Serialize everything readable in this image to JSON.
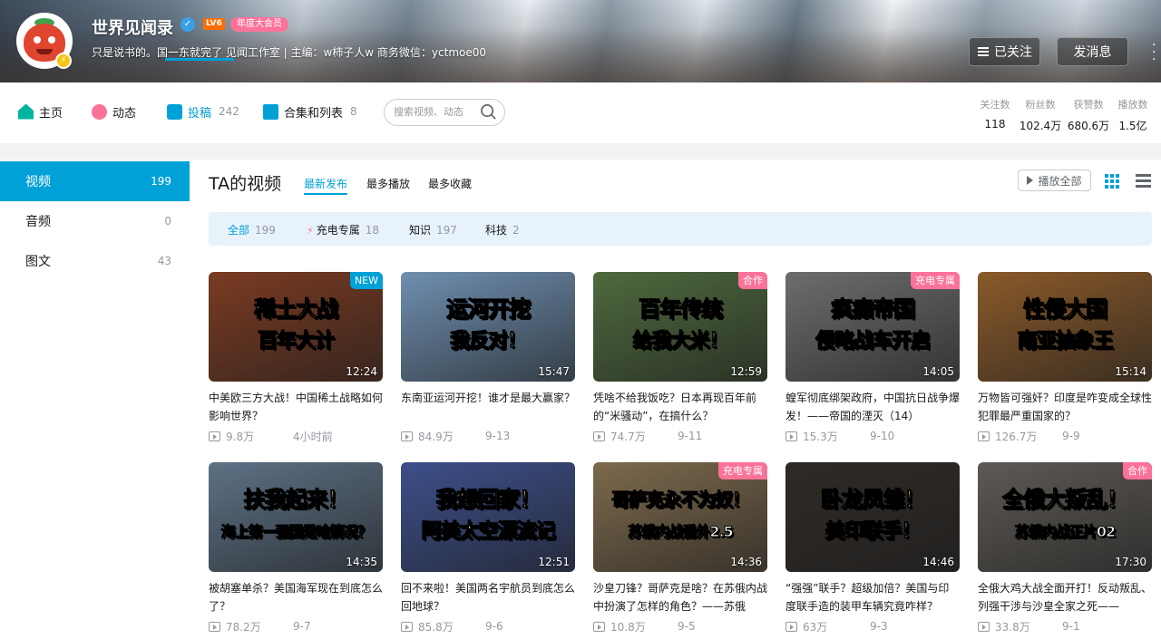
{
  "header": {
    "username": "世界见闻录",
    "level": "LV6",
    "vip_badge": "年度大会员",
    "signature": "只是说书的。国一东就完了 见闻工作室 | 主编：w柿子人w 商务微信：yctmoe00",
    "follow_label": "已关注",
    "message_label": "发消息"
  },
  "nav": {
    "home": "主页",
    "dynamic": "动态",
    "posts": "投稿",
    "posts_count": "242",
    "collections": "合集和列表",
    "collections_count": "8",
    "search_placeholder": "搜索视频、动态"
  },
  "stats": [
    {
      "label": "关注数",
      "value": "118"
    },
    {
      "label": "粉丝数",
      "value": "102.4万"
    },
    {
      "label": "获赞数",
      "value": "680.6万"
    },
    {
      "label": "播放数",
      "value": "1.5亿"
    }
  ],
  "sidebar": {
    "items": [
      {
        "label": "视频",
        "count": "199"
      },
      {
        "label": "音频",
        "count": "0"
      },
      {
        "label": "图文",
        "count": "43"
      }
    ]
  },
  "main": {
    "title": "TA的视频",
    "sort_tabs": [
      "最新发布",
      "最多播放",
      "最多收藏"
    ],
    "play_all": "播放全部",
    "filters": [
      {
        "label": "全部",
        "count": "199"
      },
      {
        "label": "充电专属",
        "count": "18"
      },
      {
        "label": "知识",
        "count": "197"
      },
      {
        "label": "科技",
        "count": "2"
      }
    ]
  },
  "videos": [
    {
      "thumb_line1": "稀土大战",
      "thumb_line2": "百年大计",
      "tag": "NEW",
      "duration": "12:24",
      "title": "中美欧三方大战！中国稀土战略如何影响世界？",
      "plays": "9.8万",
      "date": "4小时前",
      "bg": "#7a3b22"
    },
    {
      "thumb_line1": "运河开挖",
      "thumb_line2": "我反对！",
      "tag": "",
      "duration": "15:47",
      "title": "东南亚运河开挖！谁才是最大赢家？",
      "plays": "84.9万",
      "date": "9-13",
      "bg": "#6f8fb0"
    },
    {
      "thumb_line1": "百年传统",
      "thumb_line2": "给我大米！",
      "tag": "合作",
      "duration": "12:59",
      "title": "凭啥不给我饭吃？日本再现百年前的“米骚动”，在搞什么？",
      "plays": "74.7万",
      "date": "9-11",
      "bg": "#4f6a3e"
    },
    {
      "thumb_line1": "疯癫帝国",
      "thumb_line2": "侵略战车开启",
      "tag": "充电专属",
      "duration": "14:05",
      "title": "蝗军彻底绑架政府，中国抗日战争爆发！——帝国的湮灭（14）",
      "plays": "15.3万",
      "date": "9-10",
      "bg": "#6d6d6d"
    },
    {
      "thumb_line1": "性侵大国",
      "thumb_line2": "南亚抽象王",
      "tag": "",
      "duration": "15:14",
      "title": "万物皆可强奸？印度是咋变成全球性犯罪最严重国家的？",
      "plays": "126.7万",
      "date": "9-9",
      "bg": "#8a5a2a"
    },
    {
      "thumb_line1": "扶我起来！",
      "thumb_line2": "海上第一强国是啥情况？",
      "tag": "",
      "duration": "14:35",
      "title": "被胡塞单杀？美国海军现在到底怎么了？",
      "plays": "78.2万",
      "date": "9-7",
      "bg": "#5d7185"
    },
    {
      "thumb_line1": "我想回家！",
      "thumb_line2": "阿美太空漂流记",
      "tag": "",
      "duration": "12:51",
      "title": "回不来啦！美国两名宇航员到底怎么回地球？",
      "plays": "85.8万",
      "date": "9-6",
      "bg": "#3d4f8a"
    },
    {
      "thumb_line1": "哥萨克永不为奴！",
      "thumb_line2": "苏俄内战番外2.5",
      "tag": "充电专属",
      "duration": "14:36",
      "title": "沙皇刀锋？哥萨克是啥？在苏俄内战中扮演了怎样的角色？——苏俄",
      "plays": "10.8万",
      "date": "9-5",
      "bg": "#7d6a4d"
    },
    {
      "thumb_line1": "卧龙凤雏！",
      "thumb_line2": "美印联手！",
      "tag": "",
      "duration": "14:46",
      "title": "“强强”联手？超级加倍？美国与印度联手造的装甲车辆究竟咋样？",
      "plays": "63万",
      "date": "9-3",
      "bg": "#2f2a26"
    },
    {
      "thumb_line1": "全俄大叛乱！",
      "thumb_line2": "苏俄内战正片02",
      "tag": "合作",
      "duration": "17:30",
      "title": "全俄大鸡大战全面开打！反动叛乱、列强干涉与沙皇全家之死——",
      "plays": "33.8万",
      "date": "9-1",
      "bg": "#5e5a55"
    }
  ]
}
